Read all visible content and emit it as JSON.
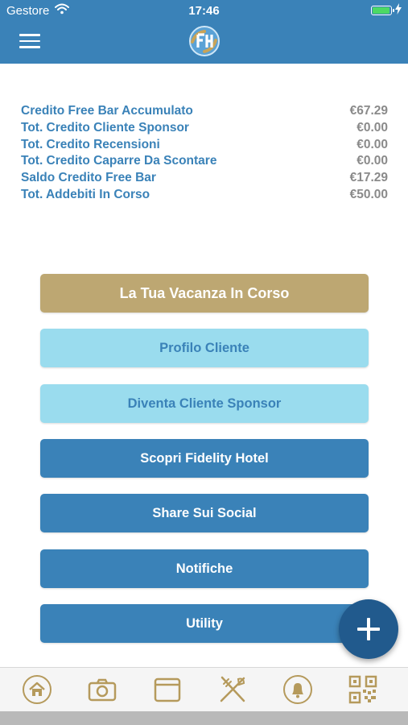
{
  "status_bar": {
    "carrier": "Gestore",
    "time": "17:46"
  },
  "nav": {
    "menu_icon": "hamburger-menu-icon",
    "logo": "fidelity-hotel-logo"
  },
  "credits": [
    {
      "label": "Credito Free Bar Accumulato",
      "value": "€67.29"
    },
    {
      "label": "Tot. Credito Cliente Sponsor",
      "value": "€0.00"
    },
    {
      "label": "Tot. Credito Recensioni",
      "value": "€0.00"
    },
    {
      "label": "Tot. Credito Caparre Da Scontare",
      "value": "€0.00"
    },
    {
      "label": "Saldo Credito Free Bar",
      "value": "€17.29"
    },
    {
      "label": "Tot. Addebiti In Corso",
      "value": "€50.00"
    }
  ],
  "buttons": [
    {
      "label": "La Tua Vacanza In Corso",
      "style": "gold"
    },
    {
      "label": "Profilo Cliente",
      "style": "light"
    },
    {
      "label": "Diventa Cliente Sponsor",
      "style": "light"
    },
    {
      "label": "Scopri Fidelity Hotel",
      "style": "blue"
    },
    {
      "label": "Share Sui Social",
      "style": "blue"
    },
    {
      "label": "Notifiche",
      "style": "blue"
    },
    {
      "label": "Utility",
      "style": "blue"
    }
  ],
  "fab": {
    "icon": "plus-icon"
  },
  "tab_bar": {
    "items": [
      {
        "icon": "home-icon"
      },
      {
        "icon": "camera-icon"
      },
      {
        "icon": "calendar-icon"
      },
      {
        "icon": "restaurant-icon"
      },
      {
        "icon": "bell-icon"
      },
      {
        "icon": "qr-code-icon"
      }
    ]
  },
  "colors": {
    "primary": "#3a82b8",
    "dark_blue": "#215a8d",
    "gold": "#bda772",
    "light_blue": "#9adcee",
    "value_gray": "#8a8a8a",
    "battery_green": "#4cd964",
    "tab_icon": "#b59a5c"
  }
}
